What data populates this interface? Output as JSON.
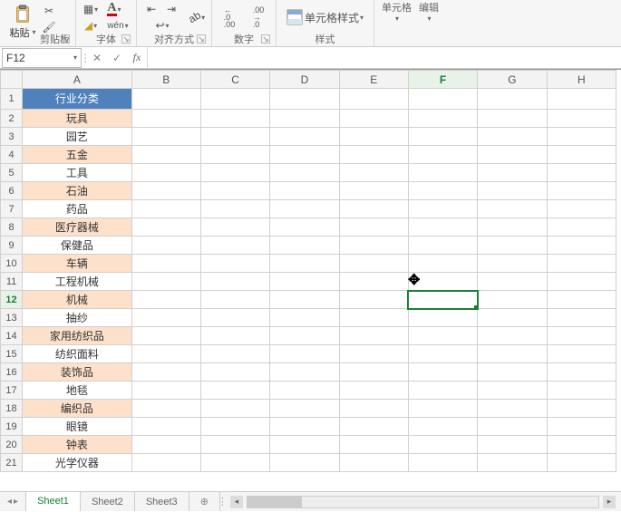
{
  "ribbon": {
    "paste_label": "粘贴",
    "groups": {
      "clipboard": "剪贴板",
      "font": "字体",
      "align": "对齐方式",
      "number": "数字",
      "style": "样式"
    },
    "cell_style_label": "单元格样式",
    "wen_label": "wén",
    "extra": {
      "cells": "单元格",
      "edit": "编辑"
    },
    "decimal_inc": ".0",
    "decimal_inc2": ".00",
    "decimal_dec": ".00",
    "decimal_dec2": ".0"
  },
  "formula": {
    "name_box": "F12",
    "cancel": "✕",
    "confirm": "✓",
    "fx": "fx",
    "value": ""
  },
  "sheet": {
    "columns": [
      "A",
      "B",
      "C",
      "D",
      "E",
      "F",
      "G",
      "H"
    ],
    "rows": 21,
    "active_col": "F",
    "active_row": 12,
    "header": "行业分类",
    "data": [
      "玩具",
      "园艺",
      "五金",
      "工具",
      "石油",
      "药品",
      "医疗器械",
      "保健品",
      "车辆",
      "工程机械",
      "机械",
      "抽纱",
      "家用纺织品",
      "纺织面料",
      "装饰品",
      "地毯",
      "编织品",
      "眼镜",
      "钟表",
      "光学仪器"
    ],
    "cursor_glyph": "✥"
  },
  "tabs": {
    "sheets": [
      "Sheet1",
      "Sheet2",
      "Sheet3"
    ],
    "active": 0,
    "add": "⊕"
  }
}
